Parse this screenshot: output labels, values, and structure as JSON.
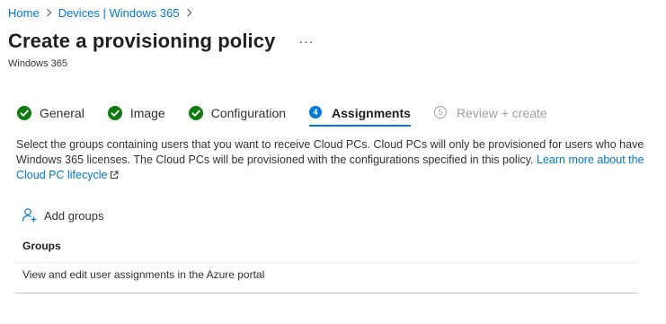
{
  "breadcrumb": {
    "items": [
      "Home",
      "Devices | Windows 365"
    ]
  },
  "header": {
    "title": "Create a provisioning policy",
    "more_label": "···",
    "subtitle": "Windows 365"
  },
  "wizard": {
    "steps": [
      {
        "label": "General",
        "state": "completed"
      },
      {
        "label": "Image",
        "state": "completed"
      },
      {
        "label": "Configuration",
        "state": "completed"
      },
      {
        "label": "Assignments",
        "state": "current",
        "number": "4"
      },
      {
        "label": "Review + create",
        "state": "disabled",
        "number": "5"
      }
    ]
  },
  "description": {
    "text": "Select the groups containing users that you want to receive Cloud PCs. Cloud PCs will only be provisioned for users who have Windows 365 licenses. The Cloud PCs will be provisioned with the configurations specified in this policy. ",
    "link_text": "Learn more about the Cloud PC lifecycle"
  },
  "toolbar": {
    "add_groups_label": "Add groups"
  },
  "groups_table": {
    "header": "Groups",
    "rows": [
      "View and edit user assignments in the Azure portal"
    ]
  },
  "colors": {
    "accent": "#0078d4",
    "success": "#107c10",
    "muted": "#a19f9d"
  }
}
